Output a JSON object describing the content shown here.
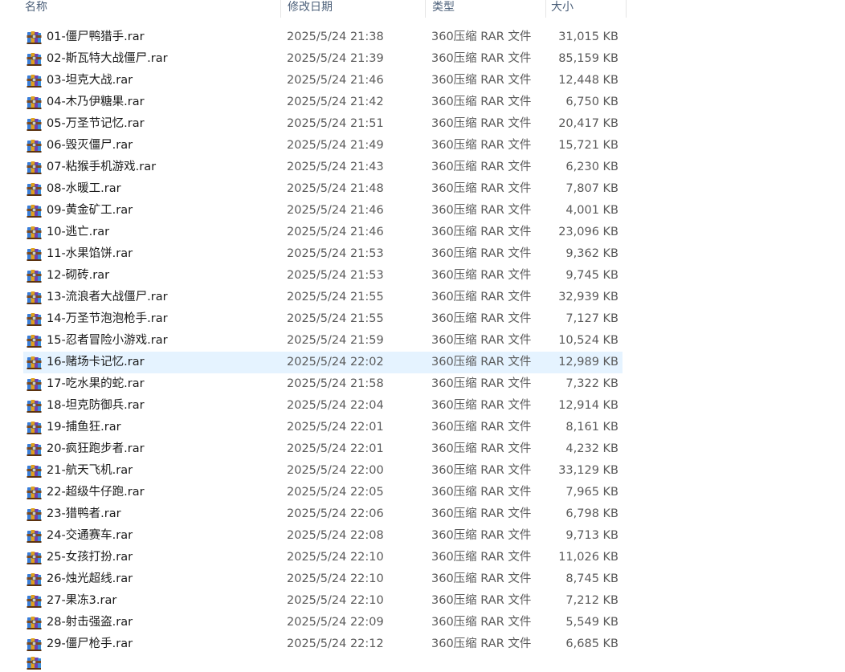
{
  "columns": {
    "name": "名称",
    "date": "修改日期",
    "type": "类型",
    "size": "大小"
  },
  "icon": "winrar-archive-icon",
  "selected_index": 15,
  "files": [
    {
      "name": "01-僵尸鸭猎手.rar",
      "date": "2025/5/24 21:38",
      "type": "360压缩 RAR 文件",
      "size": "31,015 KB"
    },
    {
      "name": "02-斯瓦特大战僵尸.rar",
      "date": "2025/5/24 21:39",
      "type": "360压缩 RAR 文件",
      "size": "85,159 KB"
    },
    {
      "name": "03-坦克大战.rar",
      "date": "2025/5/24 21:46",
      "type": "360压缩 RAR 文件",
      "size": "12,448 KB"
    },
    {
      "name": "04-木乃伊糖果.rar",
      "date": "2025/5/24 21:42",
      "type": "360压缩 RAR 文件",
      "size": "6,750 KB"
    },
    {
      "name": "05-万圣节记忆.rar",
      "date": "2025/5/24 21:51",
      "type": "360压缩 RAR 文件",
      "size": "20,417 KB"
    },
    {
      "name": "06-毁灭僵尸.rar",
      "date": "2025/5/24 21:49",
      "type": "360压缩 RAR 文件",
      "size": "15,721 KB"
    },
    {
      "name": "07-粘猴手机游戏.rar",
      "date": "2025/5/24 21:43",
      "type": "360压缩 RAR 文件",
      "size": "6,230 KB"
    },
    {
      "name": "08-水暖工.rar",
      "date": "2025/5/24 21:48",
      "type": "360压缩 RAR 文件",
      "size": "7,807 KB"
    },
    {
      "name": "09-黄金矿工.rar",
      "date": "2025/5/24 21:46",
      "type": "360压缩 RAR 文件",
      "size": "4,001 KB"
    },
    {
      "name": "10-逃亡.rar",
      "date": "2025/5/24 21:46",
      "type": "360压缩 RAR 文件",
      "size": "23,096 KB"
    },
    {
      "name": "11-水果馅饼.rar",
      "date": "2025/5/24 21:53",
      "type": "360压缩 RAR 文件",
      "size": "9,362 KB"
    },
    {
      "name": "12-砌砖.rar",
      "date": "2025/5/24 21:53",
      "type": "360压缩 RAR 文件",
      "size": "9,745 KB"
    },
    {
      "name": "13-流浪者大战僵尸.rar",
      "date": "2025/5/24 21:55",
      "type": "360压缩 RAR 文件",
      "size": "32,939 KB"
    },
    {
      "name": "14-万圣节泡泡枪手.rar",
      "date": "2025/5/24 21:55",
      "type": "360压缩 RAR 文件",
      "size": "7,127 KB"
    },
    {
      "name": "15-忍者冒险小游戏.rar",
      "date": "2025/5/24 21:59",
      "type": "360压缩 RAR 文件",
      "size": "10,524 KB"
    },
    {
      "name": "16-赌场卡记忆.rar",
      "date": "2025/5/24 22:02",
      "type": "360压缩 RAR 文件",
      "size": "12,989 KB"
    },
    {
      "name": "17-吃水果的蛇.rar",
      "date": "2025/5/24 21:58",
      "type": "360压缩 RAR 文件",
      "size": "7,322 KB"
    },
    {
      "name": "18-坦克防御兵.rar",
      "date": "2025/5/24 22:04",
      "type": "360压缩 RAR 文件",
      "size": "12,914 KB"
    },
    {
      "name": "19-捕鱼狂.rar",
      "date": "2025/5/24 22:01",
      "type": "360压缩 RAR 文件",
      "size": "8,161 KB"
    },
    {
      "name": "20-疯狂跑步者.rar",
      "date": "2025/5/24 22:01",
      "type": "360压缩 RAR 文件",
      "size": "4,232 KB"
    },
    {
      "name": "21-航天飞机.rar",
      "date": "2025/5/24 22:00",
      "type": "360压缩 RAR 文件",
      "size": "33,129 KB"
    },
    {
      "name": "22-超级牛仔跑.rar",
      "date": "2025/5/24 22:05",
      "type": "360压缩 RAR 文件",
      "size": "7,965 KB"
    },
    {
      "name": "23-猎鸭者.rar",
      "date": "2025/5/24 22:06",
      "type": "360压缩 RAR 文件",
      "size": "6,798 KB"
    },
    {
      "name": "24-交通赛车.rar",
      "date": "2025/5/24 22:08",
      "type": "360压缩 RAR 文件",
      "size": "9,713 KB"
    },
    {
      "name": "25-女孩打扮.rar",
      "date": "2025/5/24 22:10",
      "type": "360压缩 RAR 文件",
      "size": "11,026 KB"
    },
    {
      "name": "26-烛光超线.rar",
      "date": "2025/5/24 22:10",
      "type": "360压缩 RAR 文件",
      "size": "8,745 KB"
    },
    {
      "name": "27-果冻3.rar",
      "date": "2025/5/24 22:10",
      "type": "360压缩 RAR 文件",
      "size": "7,212 KB"
    },
    {
      "name": "28-射击强盗.rar",
      "date": "2025/5/24 22:09",
      "type": "360压缩 RAR 文件",
      "size": "5,549 KB"
    },
    {
      "name": "29-僵尸枪手.rar",
      "date": "2025/5/24 22:12",
      "type": "360压缩 RAR 文件",
      "size": "6,685 KB"
    }
  ]
}
